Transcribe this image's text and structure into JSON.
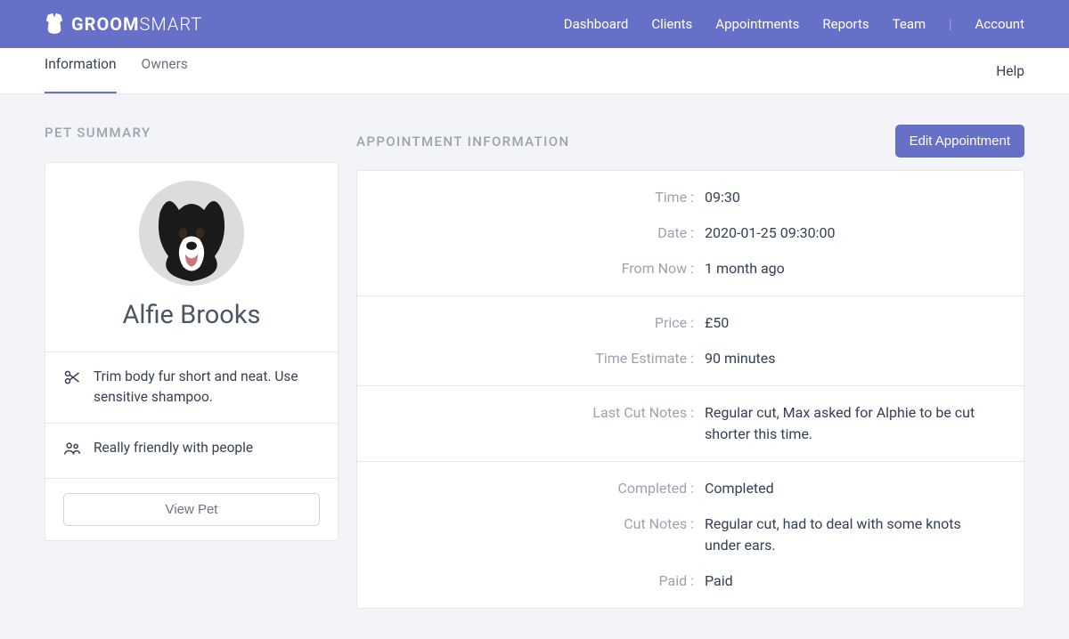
{
  "brand": {
    "strong": "GROOM",
    "light": "SMART"
  },
  "nav": {
    "dashboard": "Dashboard",
    "clients": "Clients",
    "appointments": "Appointments",
    "reports": "Reports",
    "team": "Team",
    "account": "Account"
  },
  "tabs": {
    "information": "Information",
    "owners": "Owners"
  },
  "help": "Help",
  "pet": {
    "section_heading": "PET SUMMARY",
    "name": "Alfie Brooks",
    "cut_notes": "Trim body fur short and neat. Use sensitive shampoo.",
    "temperament": "Really friendly with people",
    "view_button": "View Pet"
  },
  "appointment_section": {
    "heading": "APPOINTMENT INFORMATION",
    "edit_button": "Edit Appointment",
    "labels": {
      "time": "Time :",
      "date": "Date :",
      "from_now": "From Now :",
      "price": "Price :",
      "time_estimate": "Time Estimate :",
      "last_cut_notes": "Last Cut Notes :",
      "completed": "Completed :",
      "cut_notes": "Cut Notes :",
      "paid": "Paid :"
    },
    "values": {
      "time": "09:30",
      "date": "2020-01-25 09:30:00",
      "from_now": "1 month ago",
      "price": "£50",
      "time_estimate": "90 minutes",
      "last_cut_notes": "Regular cut, Max asked for Alphie to be cut shorter this time.",
      "completed": "Completed",
      "cut_notes": "Regular cut, had to deal with some knots under ears.",
      "paid": "Paid"
    }
  }
}
